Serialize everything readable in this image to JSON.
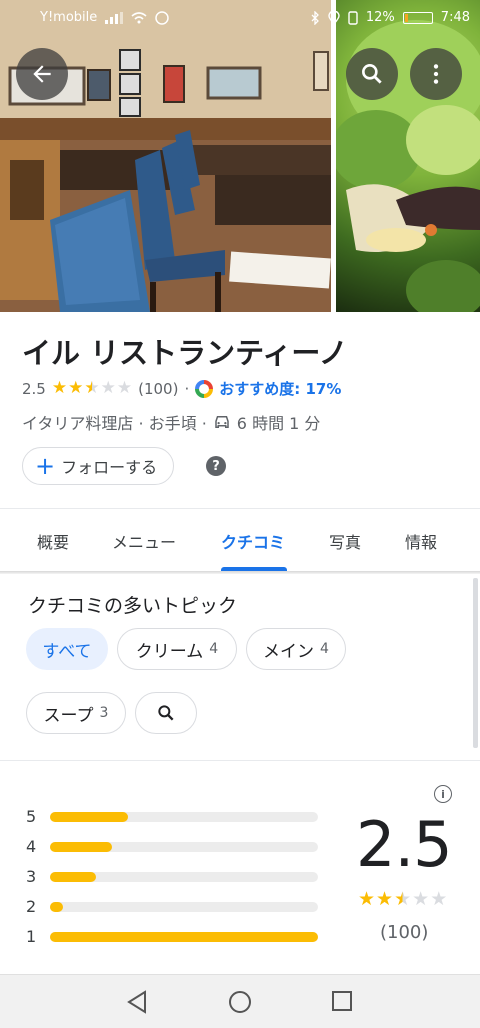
{
  "status_bar": {
    "carrier": "Y!mobile",
    "battery": "12%",
    "time": "7:48",
    "battery_level": 0.12
  },
  "place": {
    "name": "イル リストランティーノ",
    "rating": "2.5",
    "stars": 2.5,
    "review_count": "(100)",
    "separator": "·",
    "recommend": "おすすめ度: 17%",
    "category_line": "イタリア料理店 · お手頃 ·",
    "drive_time": "6 時間 1 分",
    "follow_label": "フォローする",
    "help_icon_text": "?"
  },
  "tabs": [
    {
      "label": "概要",
      "active": false
    },
    {
      "label": "メニュー",
      "active": false
    },
    {
      "label": "クチコミ",
      "active": true
    },
    {
      "label": "写真",
      "active": false
    },
    {
      "label": "情報",
      "active": false
    }
  ],
  "topics": {
    "title": "クチコミの多いトピック",
    "chips": [
      {
        "label": "すべて",
        "count": "",
        "selected": true
      },
      {
        "label": "クリーム",
        "count": "4",
        "selected": false
      },
      {
        "label": "メイン",
        "count": "4",
        "selected": false
      },
      {
        "label": "スープ",
        "count": "3",
        "selected": false
      }
    ]
  },
  "summary": {
    "score": "2.5",
    "stars": 2.5,
    "count": "(100)",
    "info_icon_text": "i",
    "histogram": [
      {
        "label": "5",
        "fraction": 0.29
      },
      {
        "label": "4",
        "fraction": 0.23
      },
      {
        "label": "3",
        "fraction": 0.17
      },
      {
        "label": "2",
        "fraction": 0.05
      },
      {
        "label": "1",
        "fraction": 1.0
      }
    ]
  },
  "colors": {
    "accent": "#1a73e8",
    "star": "#fbbc04",
    "chip_selected_bg": "#e8f0fe"
  },
  "icons": [
    "back-arrow-icon",
    "search-icon",
    "more-vert-icon",
    "star-icon",
    "gauge-icon",
    "car-icon",
    "plus-icon",
    "help-icon",
    "info-icon",
    "nav-back-icon",
    "nav-home-icon",
    "nav-recents-icon"
  ]
}
